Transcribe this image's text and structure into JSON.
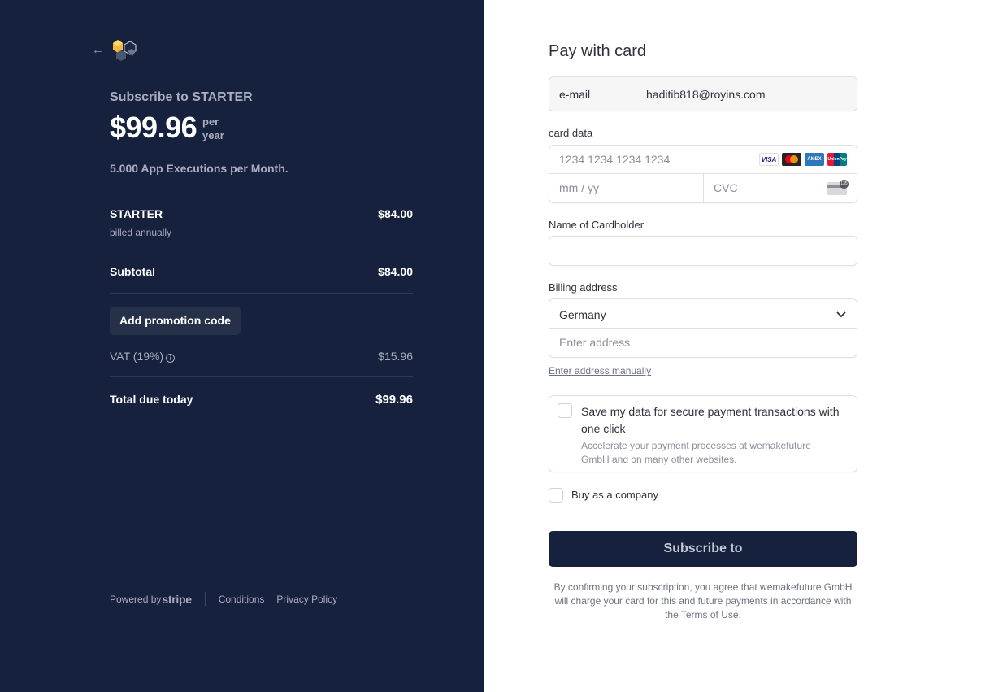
{
  "summary": {
    "subscribe_label": "Subscribe to STARTER",
    "price": "$99.96",
    "per": "per",
    "period": "year",
    "description": "5.000 App Executions per Month.",
    "items": [
      {
        "name": "STARTER",
        "detail": "billed annually",
        "amount": "$84.00"
      }
    ],
    "subtotal_label": "Subtotal",
    "subtotal_value": "$84.00",
    "promo_button": "Add promotion code",
    "vat_label": "VAT (19%)",
    "vat_value": "$15.96",
    "total_label": "Total due today",
    "total_value": "$99.96"
  },
  "footer": {
    "powered_by": "Powered by",
    "stripe": "stripe",
    "conditions": "Conditions",
    "privacy": "Privacy Policy"
  },
  "form": {
    "title": "Pay with card",
    "email_label": "e-mail",
    "email_value": "haditib818@royins.com",
    "card_label": "card data",
    "card_number_placeholder": "1234 1234 1234 1234",
    "expiry_placeholder": "mm / yy",
    "cvc_placeholder": "CVC",
    "cvc_icon_text": "135",
    "card_brands": [
      "VISA",
      "MC",
      "AMEX",
      "UnionPay"
    ],
    "cardholder_label": "Name of Cardholder",
    "cardholder_value": "",
    "billing_label": "Billing address",
    "country": "Germany",
    "address_placeholder": "Enter address",
    "manual_address_link": "Enter address manually",
    "save_title": "Save my data for secure payment transactions with one click",
    "save_subtitle": "Accelerate your payment processes at wemakefuture GmbH and on many other websites.",
    "company_label": "Buy as a company",
    "subscribe_button": "Subscribe to",
    "legal": "By confirming your subscription, you agree that wemakefuture GmbH will charge your card for this and future payments in accordance with the Terms of Use."
  },
  "colors": {
    "panel_bg": "#16213d",
    "button_bg": "#16213d",
    "muted_text": "#a8aebd"
  }
}
